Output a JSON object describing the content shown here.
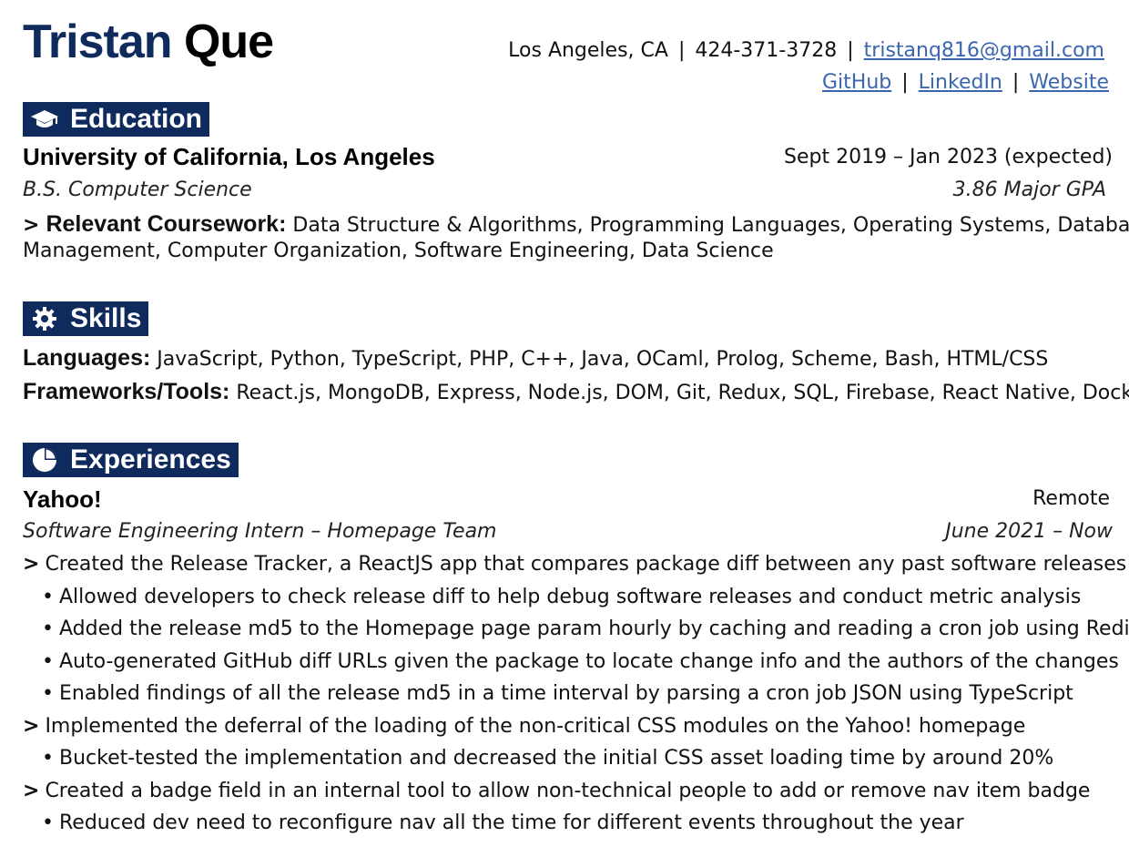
{
  "header": {
    "first_name": "Tristan",
    "last_name": "Que",
    "location": "Los Angeles, CA",
    "phone": "424-371-3728",
    "email": "tristanq816@gmail.com",
    "sep": "|",
    "links": [
      "GitHub",
      "LinkedIn",
      "Website"
    ]
  },
  "education": {
    "title": "Education",
    "school": "University of California, Los Angeles",
    "dates": "Sept 2019 – Jan 2023 (expected)",
    "degree": "B.S. Computer Science",
    "gpa": "3.86 Major GPA",
    "coursework_marker": ">",
    "coursework_label": "Relevant Coursework:",
    "coursework_line1": "Data Structure & Algorithms, Programming Languages, Operating Systems, Database",
    "coursework_line2": "Management, Computer Organization, Software Engineering, Data Science"
  },
  "skills": {
    "title": "Skills",
    "languages_label": "Languages:",
    "languages": "JavaScript, Python, TypeScript, PHP, C++, Java, OCaml, Prolog, Scheme, Bash, HTML/CSS",
    "frameworks_label": "Frameworks/Tools:",
    "frameworks": "React.js, MongoDB, Express, Node.js, DOM, Git, Redux, SQL, Firebase, React Native, Docker"
  },
  "experiences": {
    "title": "Experiences",
    "company": "Yahoo!",
    "location": "Remote",
    "role": "Software Engineering Intern – Homepage Team",
    "dates": "June 2021 – Now",
    "items": [
      {
        "marker": ">",
        "text": "Created the Release Tracker, a ReactJS app that compares package diff between any past software releases"
      },
      {
        "marker": "•",
        "text": "Allowed developers to check release diff to help debug software releases and conduct metric analysis"
      },
      {
        "marker": "•",
        "text": "Added the release md5 to the Homepage page param hourly by caching and reading a cron job using Redis"
      },
      {
        "marker": "•",
        "text": "Auto-generated GitHub diff URLs given the package to locate change info and the authors of the changes"
      },
      {
        "marker": "•",
        "text": "Enabled findings of all the release md5 in a time interval by parsing a cron job JSON using TypeScript"
      },
      {
        "marker": ">",
        "text": "Implemented the deferral of the loading of the non-critical CSS modules on the Yahoo! homepage"
      },
      {
        "marker": "•",
        "text": "Bucket-tested the implementation and decreased the initial CSS asset loading time by around 20%"
      },
      {
        "marker": ">",
        "text": "Created a badge field in an internal tool to allow non-technical people to add or remove nav item badge"
      },
      {
        "marker": "•",
        "text": "Reduced dev need to reconfigure nav all the time for different events throughout the year"
      }
    ]
  },
  "icons": {
    "education": "graduation-cap-icon",
    "skills": "gear-icon",
    "experiences": "pie-chart-icon"
  },
  "colors": {
    "accent": "#0f2a5c",
    "link": "#3a66b0"
  }
}
